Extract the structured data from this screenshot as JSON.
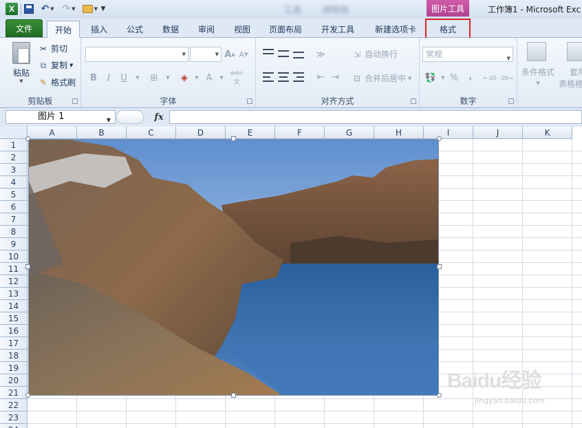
{
  "title_bar": {
    "app_icon_letter": "X",
    "picture_tools_label": "图片工具",
    "window_title": "工作簿1 - Microsoft Exc",
    "blurred_text": [
      "工具",
      "绑帮助"
    ]
  },
  "tabs": [
    {
      "id": "file",
      "label": "文件"
    },
    {
      "id": "home",
      "label": "开始"
    },
    {
      "id": "insert",
      "label": "插入"
    },
    {
      "id": "formulas",
      "label": "公式"
    },
    {
      "id": "data",
      "label": "数据"
    },
    {
      "id": "review",
      "label": "审阅"
    },
    {
      "id": "view",
      "label": "视图"
    },
    {
      "id": "layout",
      "label": "页面布局"
    },
    {
      "id": "developer",
      "label": "开发工具"
    },
    {
      "id": "custom",
      "label": "新建选项卡"
    },
    {
      "id": "format",
      "label": "格式"
    }
  ],
  "ribbon": {
    "clipboard": {
      "group_label": "剪贴板",
      "paste": "粘贴",
      "cut": "剪切",
      "copy": "复制",
      "format_painter": "格式刷"
    },
    "font": {
      "group_label": "字体",
      "font_name": "",
      "font_size": "",
      "bold": "B",
      "italic": "I",
      "underline": "U",
      "grow": "A",
      "shrink": "A",
      "font_color_glyph": "A",
      "phonetic": "wén"
    },
    "alignment": {
      "group_label": "对齐方式",
      "wrap_text": "自动换行",
      "merge_center": "合并后居中"
    },
    "number": {
      "group_label": "数字",
      "format": "常规",
      "percent": "%",
      "comma": ",",
      "inc_decimal": ".00",
      "dec_decimal": ".00"
    },
    "styles": {
      "conditional": "条件格式",
      "table_format_1": "套用",
      "table_format_2": "表格格"
    }
  },
  "formula_bar": {
    "name_box": "图片 1",
    "fx": "fx",
    "formula": ""
  },
  "grid": {
    "columns": [
      "A",
      "B",
      "C",
      "D",
      "E",
      "F",
      "G",
      "H",
      "I",
      "J",
      "K"
    ],
    "rows": [
      "1",
      "2",
      "3",
      "4",
      "5",
      "6",
      "7",
      "8",
      "9",
      "10",
      "11",
      "12",
      "13",
      "14",
      "15",
      "16",
      "17",
      "18",
      "19",
      "20",
      "21",
      "22",
      "23",
      "24"
    ]
  },
  "watermark": {
    "brand": "Baidu经验",
    "url": "jingyan.baidu.com"
  },
  "colors": {
    "file_tab": "#2e7d32",
    "picture_tools": "#c04f9c",
    "highlight_box": "#e02020"
  }
}
